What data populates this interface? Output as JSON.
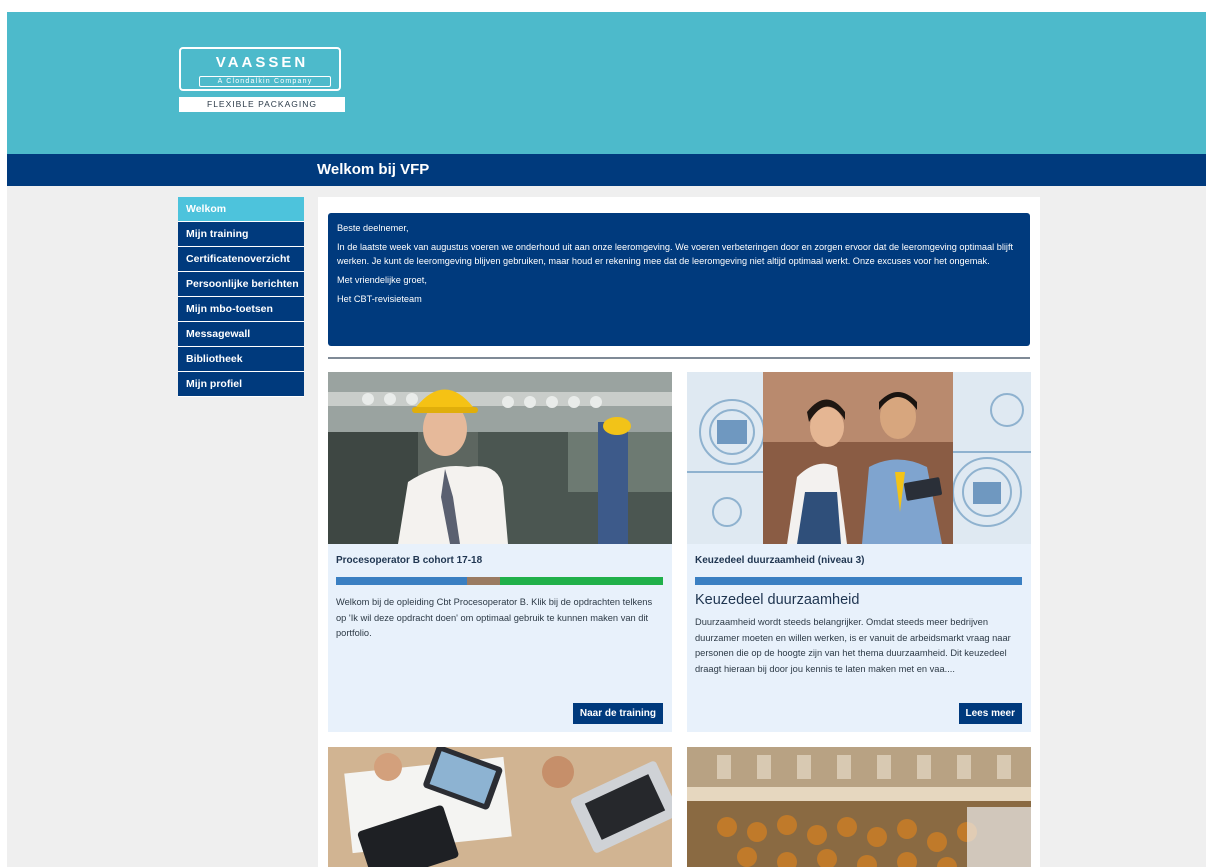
{
  "logo": {
    "name": "VAASSEN",
    "subline": "A Clondalkin Company",
    "band": "FLEXIBLE PACKAGING"
  },
  "title": "Welkom bij VFP",
  "nav": [
    {
      "label": "Welkom",
      "active": true
    },
    {
      "label": "Mijn training",
      "active": false
    },
    {
      "label": "Certificatenoverzicht",
      "active": false
    },
    {
      "label": "Persoonlijke berichten",
      "active": false
    },
    {
      "label": "Mijn mbo-toetsen",
      "active": false
    },
    {
      "label": "Messagewall",
      "active": false
    },
    {
      "label": "Bibliotheek",
      "active": false
    },
    {
      "label": "Mijn profiel",
      "active": false
    }
  ],
  "notice": {
    "greeting": "Beste deelnemer,",
    "body": "In de laatste week van augustus voeren we onderhoud uit aan onze leeromgeving. We voeren verbeteringen door en zorgen ervoor dat de leeromgeving optimaal blijft werken. Je kunt de leeromgeving blijven gebruiken, maar houd er rekening mee dat de leeromgeving niet altijd optimaal werkt. Onze excuses voor het ongemak.",
    "closing": "Met vriendelijke groet,",
    "signature": "Het CBT-revisieteam"
  },
  "cards": [
    {
      "title": "Procesoperator B cohort 17-18",
      "text": "Welkom bij de opleiding Cbt Procesoperator B. Klik bij de opdrachten telkens op 'Ik wil deze opdracht doen' om optimaal gebruik te kunnen maken van dit portfolio.",
      "button": "Naar de training",
      "progress": {
        "blue": 0.4,
        "brown": 0.1,
        "green": 0.5
      }
    },
    {
      "title": "Keuzedeel duurzaamheid (niveau 3)",
      "heading": "Keuzedeel duurzaamheid",
      "text": "Duurzaamheid wordt steeds belangrijker. Omdat steeds meer bedrijven duurzamer moeten en willen werken, is er vanuit de arbeidsmarkt vraag naar personen die op de hoogte zijn van het thema duurzaamheid. Dit keuzedeel draagt hieraan bij door jou kennis te laten maken met en vaa....",
      "button": "Lees meer"
    }
  ],
  "colors": {
    "header": "#4dbacb",
    "navy": "#003a7d",
    "active_nav": "#4dc3dc",
    "card_bg": "#e8f1fb",
    "progress_blue": "#3a7fc2",
    "progress_brown": "#9a7b62",
    "progress_green": "#20b04a"
  }
}
